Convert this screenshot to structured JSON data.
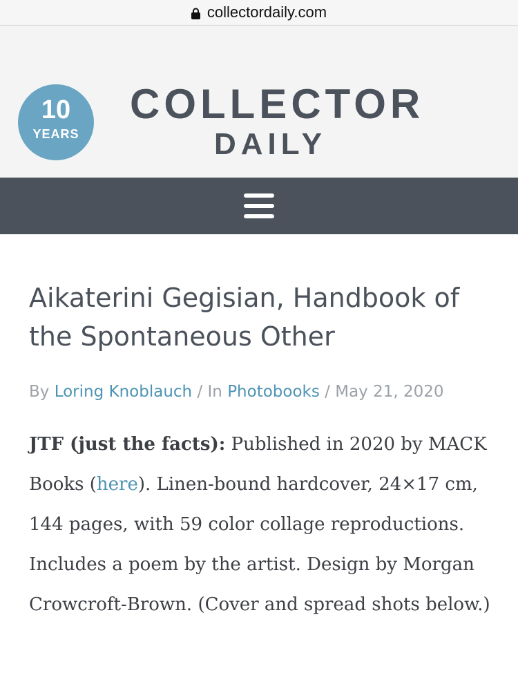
{
  "browser": {
    "url": "collectordaily.com"
  },
  "masthead": {
    "badge_number": "10",
    "badge_text": "YEARS",
    "logo_line1": "COLLECTOR",
    "logo_line2": "DAILY",
    "brand_color": "#4b525b",
    "badge_color": "#6aa6c3"
  },
  "nav": {
    "menu_icon": "hamburger-menu-icon"
  },
  "article": {
    "title": "Aikaterini Gegisian, Handbook of the Spontaneous Other",
    "meta": {
      "by_prefix": "By",
      "author": "Loring Knoblauch",
      "in_prefix": "/ In",
      "category": "Photobooks",
      "date_prefix": "/",
      "date": "May 21, 2020"
    },
    "jtf_label": "JTF (just the facts):",
    "jtf_part1": "Published in 2020 by MACK Books (",
    "link_text": "here",
    "jtf_part2": "). Linen-bound hardcover, 24×17 cm, 144 pages, with 59 color collage reproductions. Includes a poem by the artist. Design by Morgan Crowcroft-Brown. (Cover and spread shots below.)",
    "link_color": "#4e94b4"
  }
}
